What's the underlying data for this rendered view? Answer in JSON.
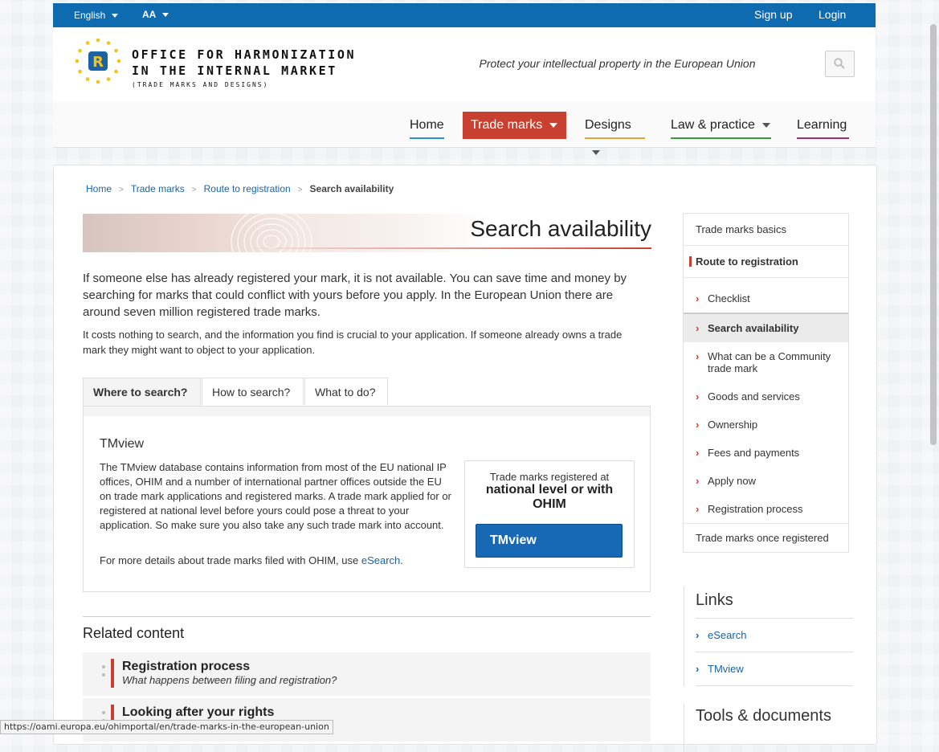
{
  "topbar": {
    "language": "English",
    "text_size": "AA",
    "signup": "Sign up",
    "login": "Login"
  },
  "header": {
    "logo_line1": "OFFICE FOR HARMONIZATION",
    "logo_line2": "IN THE INTERNAL MARKET",
    "logo_line3": "(TRADE MARKS AND DESIGNS)",
    "tagline": "Protect your intellectual property in the European Union"
  },
  "nav": {
    "home": "Home",
    "trade_marks": "Trade marks",
    "designs": "Designs",
    "law_practice": "Law & practice",
    "learning": "Learning"
  },
  "colors": {
    "accent_red": "#c8402f",
    "brand_blue": "#0e6bb0",
    "home_underline": "#2a8fd0",
    "designs_underline": "#e6a23c",
    "law_underline": "#3a9a3a",
    "learning_underline": "#a0306a"
  },
  "breadcrumb": {
    "home": "Home",
    "trade_marks": "Trade marks",
    "route": "Route to registration",
    "current": "Search availability"
  },
  "page": {
    "title": "Search availability",
    "intro1": "If someone else has already registered your mark, it is not available. You can save time and money by searching for marks that could conflict with yours before you apply. In the European Union there are around seven million registered trade marks.",
    "intro2": "It costs nothing to search, and the information you find is crucial to your application. If someone already owns a trade mark they might want to object to your application."
  },
  "tabs": {
    "where": "Where to search?",
    "how": "How to search?",
    "what": "What to do?"
  },
  "tmview": {
    "title": "TMview",
    "body": "The TMview database contains information from most of the EU national IP offices, OHIM and a number of international partner offices outside the EU on trade mark applications and registered marks. A trade mark applied for or registered at national level before yours could pose a threat to your application. So make sure you also take any such trade mark into account.",
    "more_prefix": "For more details about trade marks filed with OHIM, use ",
    "more_link": "eSearch",
    "more_suffix": ".",
    "callout_line1": "Trade marks registered at",
    "callout_line2": "national level or with OHIM",
    "button": "TMview"
  },
  "related": {
    "title": "Related content",
    "items": [
      {
        "title": "Registration process",
        "subtitle": "What happens between filing and registration?"
      },
      {
        "title": "Looking after your rights",
        "subtitle": ""
      }
    ]
  },
  "sidenav": {
    "basics": "Trade marks basics",
    "route": "Route to registration",
    "children": [
      "Checklist",
      "Search availability",
      "What can be a Community trade mark",
      "Goods and services",
      "Ownership",
      "Fees and payments",
      "Apply now",
      "Registration process"
    ],
    "once_registered": "Trade marks once registered"
  },
  "links": {
    "title": "Links",
    "items": [
      "eSearch",
      "TMview"
    ]
  },
  "tools": {
    "title": "Tools & documents"
  },
  "statusbar": {
    "url": "https://oami.europa.eu/ohimportal/en/trade-marks-in-the-european-union"
  }
}
